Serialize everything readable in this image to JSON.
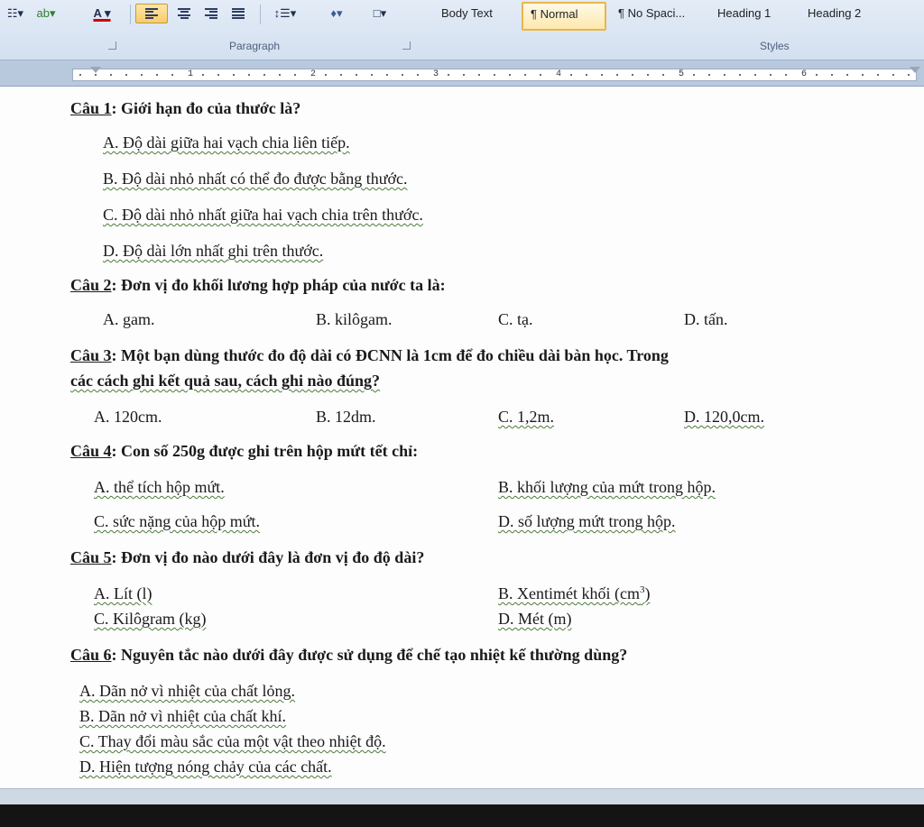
{
  "ribbon": {
    "paragraph_label": "Paragraph",
    "styles_label": "Styles",
    "styles": [
      {
        "label": "Body Text"
      },
      {
        "label": "¶ Normal"
      },
      {
        "label": "¶ No Spaci..."
      },
      {
        "label": "Heading 1"
      },
      {
        "label": "Heading 2"
      }
    ]
  },
  "ruler": {
    "numbers": [
      "1",
      "2",
      "3",
      "4",
      "5",
      "6"
    ]
  },
  "doc": {
    "q1": {
      "num": "Câu 1",
      "text": ": Giới hạn đo của thước là?",
      "a": "A. Độ dài giữa hai vạch chia liên tiếp.",
      "b": "B. Độ dài nhỏ nhất có thể đo được bằng thước.",
      "c": "C. Độ dài nhỏ nhất giữa hai vạch chia trên thước.",
      "d": "D. Độ dài lớn nhất ghi trên thước."
    },
    "q2": {
      "num": "Câu 2",
      "text": ": Đơn vị đo khối lương  hợp pháp của nước ta là:",
      "a": "A. gam.",
      "b": "B. kilôgam.",
      "c": "C. tạ.",
      "d": "D. tấn."
    },
    "q3": {
      "num": "Câu 3",
      "text1": ": Một bạn dùng thước đo độ dài có ĐCNN là 1cm để đo chiều dài bàn học. Trong",
      "text2": "các cách ghi kết quả sau, cách ghi nào đúng?",
      "a": "A. 120cm.",
      "b": "B. 12dm.",
      "c": "C. 1,2m.",
      "d": "D. 120,0cm."
    },
    "q4": {
      "num": "Câu 4",
      "text": ": Con số 250g được ghi trên hộp mứt tết chỉ:",
      "a": "A. thể tích hộp mứt.",
      "b": "B. khối lượng của mứt trong hộp.",
      "c": "C. sức nặng của hộp mứt.",
      "d": "D. số lượng mứt trong hộp."
    },
    "q5": {
      "num": "Câu 5",
      "text": ": Đơn vị đo nào dưới đây là đơn vị đo độ dài?",
      "a": "A. Lít (l)",
      "b": "B. Xentimét khối (cm",
      "b_sup": "3",
      "b_end": ")",
      "c": "C. Kilôgram (kg)",
      "d": "D. Mét (m)"
    },
    "q6": {
      "num": "Câu 6",
      "text": ": Nguyên tắc nào dưới đây được sử dụng để chế tạo nhiệt kế thường dùng?",
      "a": "A.  Dãn nở vì nhiệt của chất lỏng.",
      "b": "B.  Dãn nở vì nhiệt của chất khí.",
      "c": "C.  Thay đổi màu sắc của một vật theo nhiệt độ.",
      "d": "D.  Hiện tượng nóng chảy của các chất."
    }
  }
}
